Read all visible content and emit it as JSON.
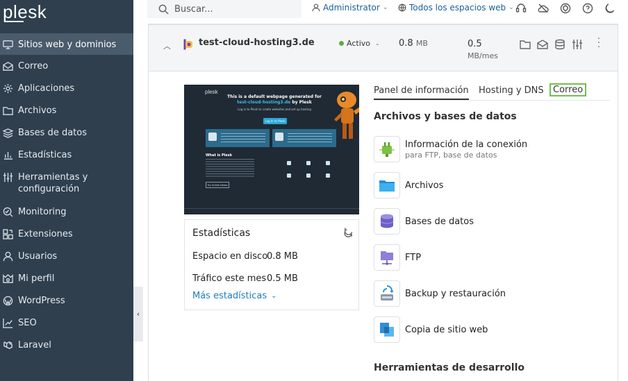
{
  "app": {
    "logo": "plesk"
  },
  "sidebar": {
    "items": [
      {
        "label": "Sitios web y dominios",
        "icon": "monitor-icon",
        "active": true
      },
      {
        "label": "Correo",
        "icon": "envelope-icon"
      },
      {
        "label": "Aplicaciones",
        "icon": "gear-icon"
      },
      {
        "label": "Archivos",
        "icon": "folder-icon"
      },
      {
        "label": "Bases de datos",
        "icon": "database-icon"
      },
      {
        "label": "Estadísticas",
        "icon": "bar-chart-icon"
      },
      {
        "label": "Herramientas y configuración",
        "icon": "sliders-icon"
      },
      {
        "label": "Monitoring",
        "icon": "monitoring-icon"
      },
      {
        "label": "Extensiones",
        "icon": "extensions-icon"
      },
      {
        "label": "Usuarios",
        "icon": "user-icon"
      },
      {
        "label": "Mi perfil",
        "icon": "profile-icon"
      },
      {
        "label": "WordPress",
        "icon": "wordpress-icon"
      },
      {
        "label": "SEO",
        "icon": "seo-icon"
      },
      {
        "label": "Laravel",
        "icon": "laravel-icon"
      }
    ],
    "collapse_glyph": "‹"
  },
  "topbar": {
    "search_placeholder": "Buscar...",
    "account": "Administrator",
    "subscriptions": "Todos los espacios web"
  },
  "site": {
    "domain": "test-cloud-hosting3.de",
    "status": "Activo",
    "disk_value": "0.8",
    "disk_unit": "MB",
    "traffic_value": "0.5",
    "traffic_unit": "MB/mes"
  },
  "preview": {
    "logo": "plesk",
    "title_line1": "This is a default webpage generated for",
    "title_domain": "test-cloud-hosting3.de",
    "title_suffix": "by Plesk",
    "subtitle": "Log in to Plesk to create websites and set up hosting",
    "login_button": "Log In to Plesk",
    "what_is": "What is Plesk",
    "try_button": "Try Online Demo"
  },
  "stats": {
    "title": "Estadísticas",
    "disk_label": "Espacio en disco",
    "disk_value": "0.8 MB",
    "traffic_label": "Tráfico este mes",
    "traffic_value": "0.5 MB",
    "more_link": "Más estadísticas"
  },
  "tabs": [
    {
      "label": "Panel de información",
      "active": true
    },
    {
      "label": "Hosting y DNS"
    },
    {
      "label": "Correo",
      "highlighted": true
    }
  ],
  "sections": {
    "files_db": "Archivos y bases de datos",
    "dev_tools": "Herramientas de desarrollo"
  },
  "tools": [
    {
      "name": "Información de la conexión",
      "desc": "para FTP, base de datos",
      "icon": "plug-icon"
    },
    {
      "name": "Archivos",
      "desc": "",
      "icon": "folder-icon"
    },
    {
      "name": "Bases de datos",
      "desc": "",
      "icon": "database-icon"
    },
    {
      "name": "FTP",
      "desc": "",
      "icon": "ftp-icon"
    },
    {
      "name": "Backup y restauración",
      "desc": "",
      "icon": "backup-icon"
    },
    {
      "name": "Copia de sitio web",
      "desc": "",
      "icon": "copy-site-icon"
    }
  ],
  "colors": {
    "sidebar_bg": "#2f3f4e",
    "active_item": "#4a5b6b",
    "link": "#1f7bc1",
    "status_active": "#5fad3d",
    "tab_highlight": "#6cc24a"
  }
}
